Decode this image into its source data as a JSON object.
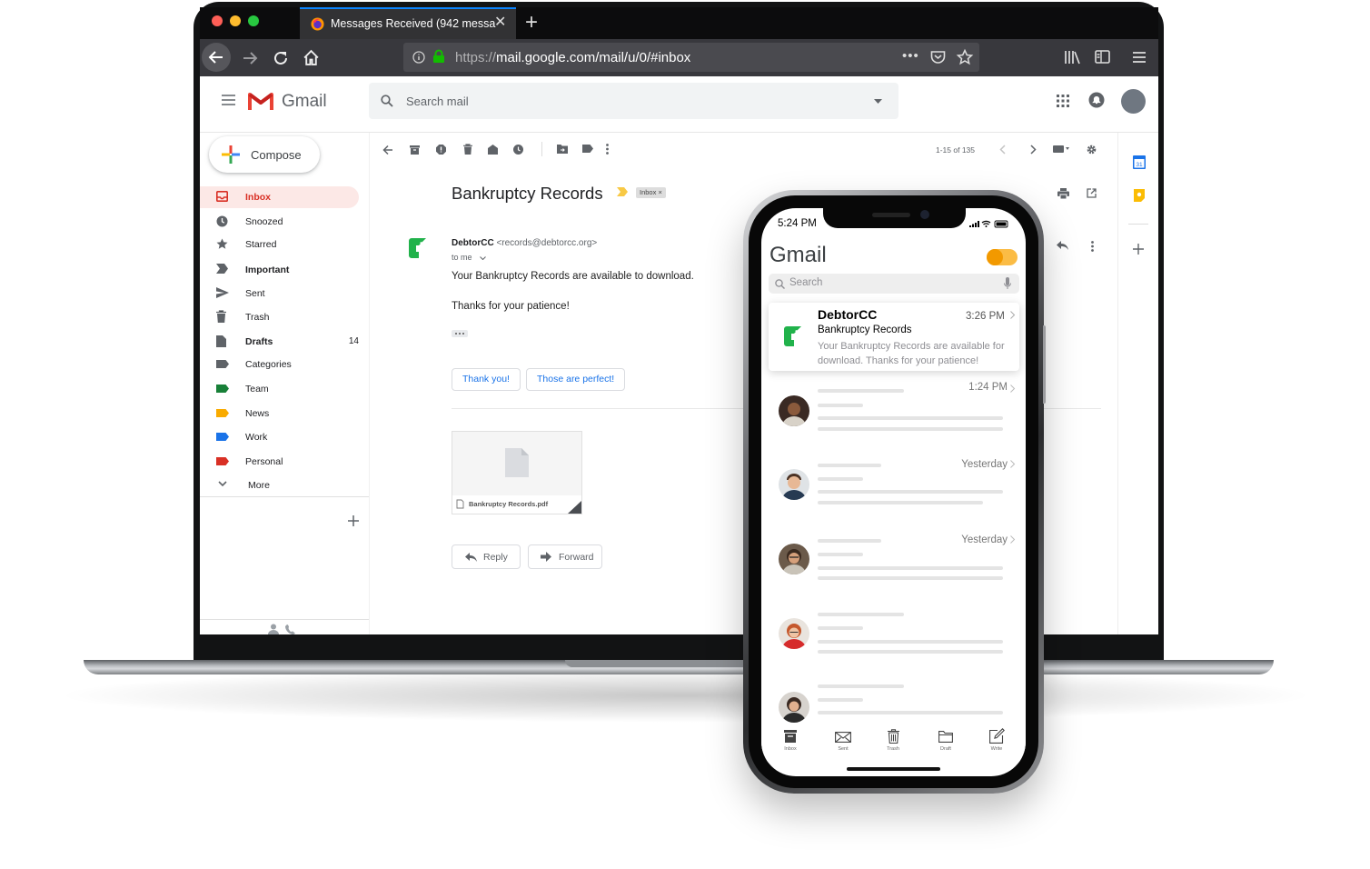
{
  "browser": {
    "tab_title": "Messages Received (942 messa",
    "url_scheme": "https://",
    "url_rest": "mail.google.com/mail/u/0/#inbox"
  },
  "gmail": {
    "app_name": "Gmail",
    "search_placeholder": "Search mail",
    "compose_label": "Compose",
    "pagination": "1-15 of 135",
    "nav": [
      {
        "label": "Inbox",
        "icon": "inbox-icon"
      },
      {
        "label": "Snoozed",
        "icon": "clock-icon"
      },
      {
        "label": "Starred",
        "icon": "star-icon"
      },
      {
        "label": "Important",
        "icon": "important-icon"
      },
      {
        "label": "Sent",
        "icon": "send-icon"
      },
      {
        "label": "Trash",
        "icon": "trash-icon"
      },
      {
        "label": "Drafts",
        "icon": "draft-icon",
        "count": "14"
      },
      {
        "label": "Categories",
        "icon": "label-icon"
      },
      {
        "label": "Team",
        "icon": "label-icon",
        "color": "#188038"
      },
      {
        "label": "News",
        "icon": "label-icon",
        "color": "#f9ab00"
      },
      {
        "label": "Work",
        "icon": "label-icon",
        "color": "#1a73e8"
      },
      {
        "label": "Personal",
        "icon": "label-icon",
        "color": "#d93025"
      },
      {
        "label": "More",
        "icon": "chevron-down-icon"
      }
    ],
    "message": {
      "subject": "Bankruptcy Records",
      "label_chip": "Inbox",
      "sender_name": "DebtorCC",
      "sender_email": "<records@debtorcc.org>",
      "to": "to me",
      "body_line1": "Your Bankruptcy Records are available to download.",
      "body_line2": "Thanks for your patience!",
      "smart_replies": [
        "Thank you!",
        "Those are perfect!"
      ],
      "attachment_name": "Bankruptcy Records.pdf",
      "reply_label": "Reply",
      "forward_label": "Forward"
    }
  },
  "phone": {
    "time": "5:24 PM",
    "title": "Gmail",
    "search_placeholder": "Search",
    "featured": {
      "from": "DebtorCC",
      "time": "3:26 PM",
      "subject": "Bankruptcy Records",
      "preview": "Your Bankruptcy Records are available for download. Thanks for your patience!"
    },
    "rows": [
      {
        "time": "1:24 PM"
      },
      {
        "time": "Yesterday"
      },
      {
        "time": "Yesterday"
      },
      {
        "time": ""
      },
      {
        "time": ""
      }
    ],
    "tabs": [
      "Inbox",
      "Sent",
      "Trash",
      "Draft",
      "Write"
    ]
  },
  "colors": {
    "gmail_red": "#d93025",
    "accent_blue": "#1a73e8",
    "brand_green": "#21b24b",
    "toggle_orange": "#f29900"
  }
}
